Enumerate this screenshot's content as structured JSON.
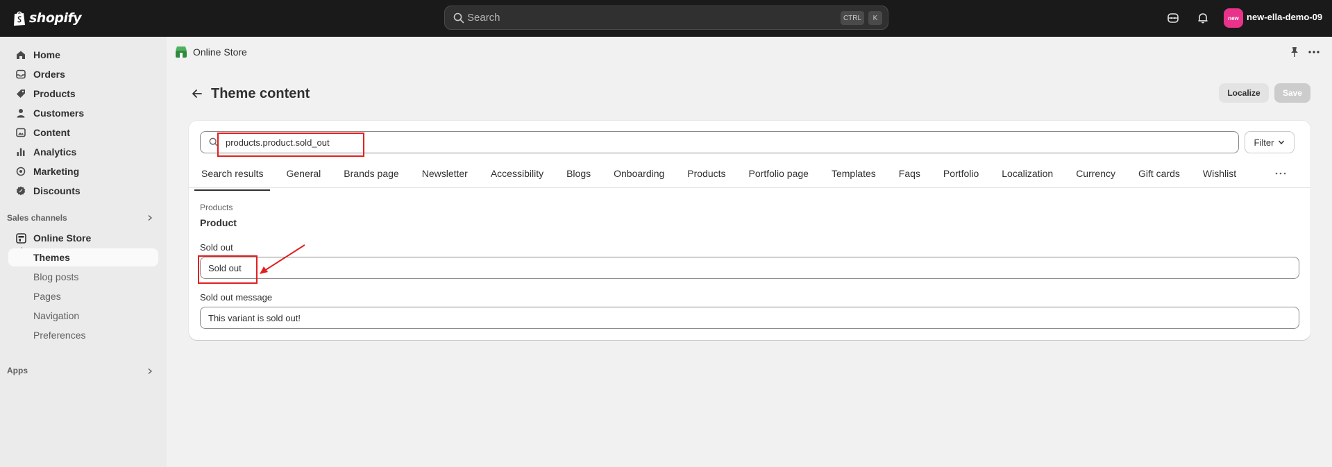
{
  "topbar": {
    "logo_text": "shopify",
    "search_placeholder": "Search",
    "shortcut_ctrl": "CTRL",
    "shortcut_k": "K",
    "store_badge": "new",
    "store_name": "new-ella-demo-09"
  },
  "sidebar": {
    "items": [
      {
        "label": "Home",
        "icon": "home-icon"
      },
      {
        "label": "Orders",
        "icon": "orders-icon"
      },
      {
        "label": "Products",
        "icon": "tag-icon"
      },
      {
        "label": "Customers",
        "icon": "person-icon"
      },
      {
        "label": "Content",
        "icon": "content-icon"
      },
      {
        "label": "Analytics",
        "icon": "bar-chart-icon"
      },
      {
        "label": "Marketing",
        "icon": "target-icon"
      },
      {
        "label": "Discounts",
        "icon": "discount-icon"
      }
    ],
    "sales_channels_label": "Sales channels",
    "online_store": "Online Store",
    "subitems": [
      "Themes",
      "Blog posts",
      "Pages",
      "Navigation",
      "Preferences"
    ],
    "apps_label": "Apps"
  },
  "header": {
    "breadcrumb": "Online Store",
    "title": "Theme content",
    "localize_label": "Localize",
    "save_label": "Save"
  },
  "card": {
    "search_value": "products.product.sold_out",
    "filter_label": "Filter",
    "tabs": [
      "Search results",
      "General",
      "Brands page",
      "Newsletter",
      "Accessibility",
      "Blogs",
      "Onboarding",
      "Products",
      "Portfolio page",
      "Templates",
      "Faqs",
      "Portfolio",
      "Localization",
      "Currency",
      "Gift cards",
      "Wishlist"
    ],
    "group_label": "Products",
    "group_title": "Product",
    "fields": [
      {
        "label": "Sold out",
        "value": "Sold out"
      },
      {
        "label": "Sold out message",
        "value": "This variant is sold out!"
      }
    ]
  },
  "colors": {
    "topbar": "#1a1a1a",
    "sidebar": "#ebebeb",
    "annotation": "#e02020",
    "store_badge": "#e9338b",
    "online_store_icon": "#2e8b3d"
  }
}
